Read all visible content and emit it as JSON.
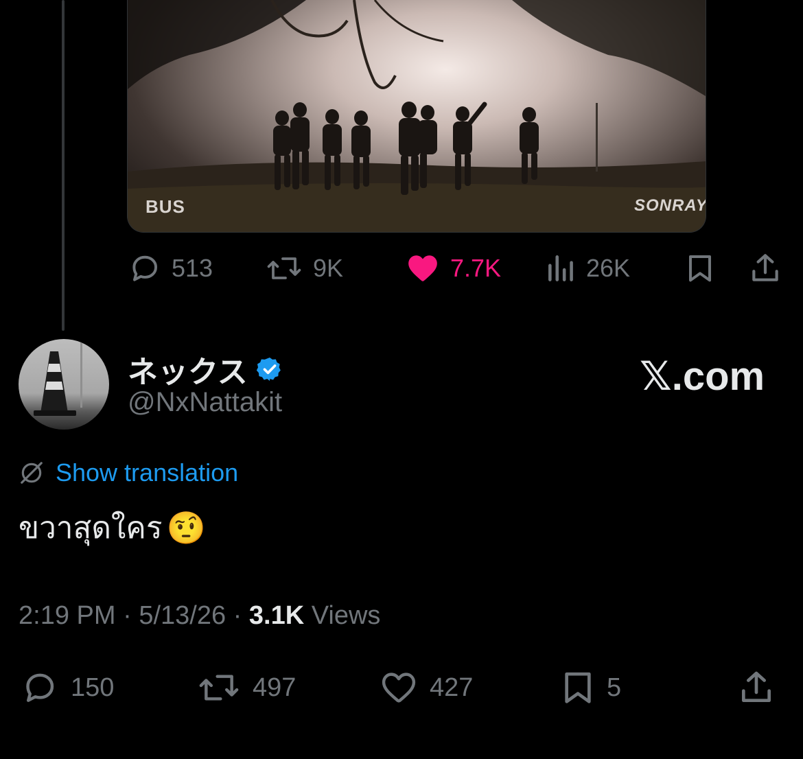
{
  "media": {
    "logo_left": "BUS",
    "logo_right": "SONRAY"
  },
  "top_actions": {
    "replies": "513",
    "reposts": "9K",
    "likes": "7.7K",
    "views": "26K",
    "liked": true,
    "like_color": "#f91880"
  },
  "author": {
    "display_name": "ネックス",
    "handle": "@NxNattakit",
    "verified_color": "#1d9bf0"
  },
  "watermark": "𝕏.com",
  "translation": {
    "label": "Show translation"
  },
  "tweet": {
    "text": "ขวาสุดใคร",
    "emoji": "🤨"
  },
  "meta": {
    "time": "2:19 PM",
    "date": "5/13/26",
    "views_count": "3.1K",
    "views_label": "Views",
    "separator": "·"
  },
  "bottom_actions": {
    "replies": "150",
    "reposts": "497",
    "likes": "427",
    "bookmarks": "5"
  },
  "colors": {
    "background": "#000000",
    "text": "#e7e9ea",
    "muted": "#71767b",
    "accent": "#1d9bf0"
  }
}
